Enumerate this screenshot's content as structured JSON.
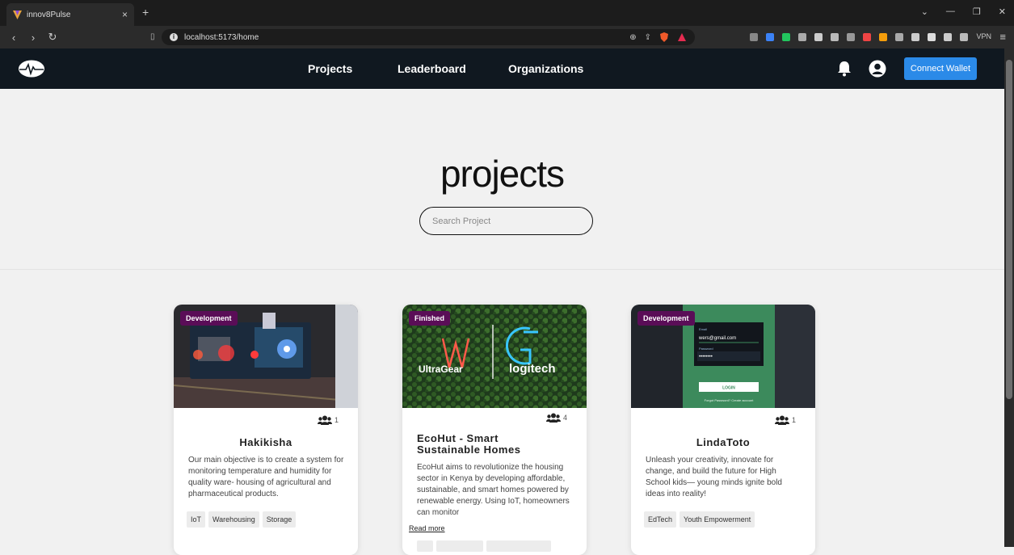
{
  "browser": {
    "tab_title": "innov8Pulse",
    "url": "localhost:5173/home",
    "vpn_label": "VPN"
  },
  "nav": {
    "links": [
      "Projects",
      "Leaderboard",
      "Organizations"
    ],
    "connect_wallet": "Connect Wallet"
  },
  "hero": {
    "title": "projects",
    "search_placeholder": "Search Project"
  },
  "projects": [
    {
      "status": "Development",
      "members": "1",
      "title": "Hakikisha",
      "description": "Our main objective is to create a system for monitoring temperature and humidity for quality ware- housing of agricultural and pharmaceutical products.",
      "tags": [
        "IoT",
        "Warehousing",
        "Storage"
      ]
    },
    {
      "status": "Finished",
      "members": "4",
      "title": "EcoHut - Smart Sustainable Homes",
      "description": "EcoHut aims to revolutionize the housing sector in Kenya by developing affordable, sustainable, and smart homes powered by renewable energy. Using IoT, homeowners can monitor",
      "read_more": "Read more",
      "image_text": {
        "brand1": "UltraGear",
        "brand2": "logitech"
      }
    },
    {
      "status": "Development",
      "members": "1",
      "title": "LindaToto",
      "description": "Unleash your creativity, innovate for change, and build the future for High School kids— young minds ignite bold ideas into reality!",
      "tags": [
        "EdTech",
        "Youth Empowerment"
      ],
      "image_text": {
        "email_label": "Email",
        "email_value": "wers@gmail.com",
        "password_label": "Password",
        "password_value": "••••••••",
        "login": "LOGIN",
        "forgot": "Forgot Password? Create account"
      }
    }
  ]
}
